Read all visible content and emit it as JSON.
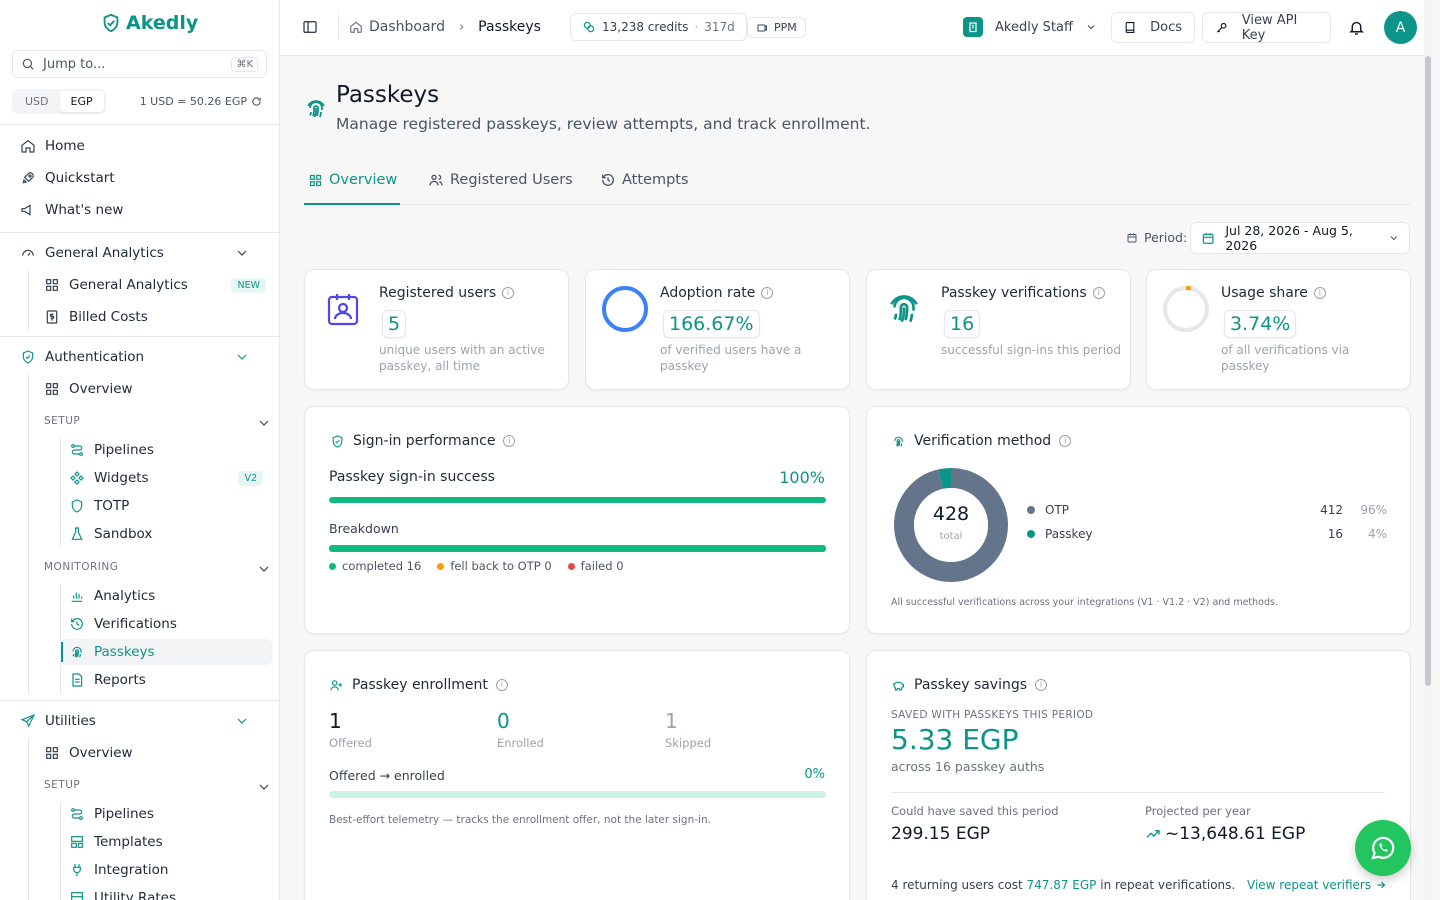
{
  "app": {
    "logo_text": "Akedly"
  },
  "sidebar": {
    "jump_placeholder": "Jump to...",
    "jump_shortcut": "⌘K",
    "currency": {
      "options": [
        "USD",
        "EGP"
      ],
      "selected": "EGP",
      "rate_text": "1 USD = 50.26 EGP"
    },
    "top_items": [
      {
        "label": "Home",
        "icon": "home-icon"
      },
      {
        "label": "Quickstart",
        "icon": "rocket-icon"
      },
      {
        "label": "What's new",
        "icon": "megaphone-icon"
      }
    ],
    "general_analytics": {
      "label": "General Analytics",
      "items": [
        {
          "label": "General Analytics",
          "badge": "NEW"
        },
        {
          "label": "Billed Costs"
        }
      ]
    },
    "authentication": {
      "label": "Authentication",
      "overview": "Overview",
      "setup_label": "SETUP",
      "setup_items": [
        {
          "label": "Pipelines"
        },
        {
          "label": "Widgets",
          "badge": "V2"
        },
        {
          "label": "TOTP"
        },
        {
          "label": "Sandbox"
        }
      ],
      "monitoring_label": "MONITORING",
      "monitoring_items": [
        {
          "label": "Analytics"
        },
        {
          "label": "Verifications"
        },
        {
          "label": "Passkeys",
          "active": true
        },
        {
          "label": "Reports"
        }
      ]
    },
    "utilities": {
      "label": "Utilities",
      "overview": "Overview",
      "setup_label": "SETUP",
      "setup_items": [
        {
          "label": "Pipelines"
        },
        {
          "label": "Templates"
        },
        {
          "label": "Integration"
        },
        {
          "label": "Utility Rates"
        }
      ]
    }
  },
  "topbar": {
    "breadcrumb": [
      "Dashboard",
      "Passkeys"
    ],
    "credits": "13,238 credits",
    "credits_days": "317d",
    "ppm_label": "PPM",
    "org_name": "Akedly Staff",
    "docs_label": "Docs",
    "api_key_label": "View API Key",
    "avatar_letter": "A"
  },
  "page": {
    "title": "Passkeys",
    "subtitle": "Manage registered passkeys, review attempts, and track enrollment.",
    "tabs": [
      {
        "label": "Overview",
        "active": true
      },
      {
        "label": "Registered Users"
      },
      {
        "label": "Attempts"
      }
    ],
    "period_label": "Period:",
    "period_value": "Jul 28, 2026 - Aug 5, 2026"
  },
  "stats": [
    {
      "title": "Registered users",
      "value": "5",
      "desc": "unique users with an active passkey, all time",
      "icon": "user-badge-icon"
    },
    {
      "title": "Adoption rate",
      "value": "166.67%",
      "desc": "of verified users have a passkey",
      "icon": "ring-icon"
    },
    {
      "title": "Passkey verifications",
      "value": "16",
      "desc": "successful sign-ins this period",
      "icon": "fingerprint-icon"
    },
    {
      "title": "Usage share",
      "value": "3.74%",
      "desc": "of all verifications via passkey",
      "icon": "usage-ring-icon",
      "fraction": 0.0374
    }
  ],
  "signin": {
    "title": "Sign-in performance",
    "success_label": "Passkey sign-in success",
    "success_value": "100%",
    "success_fraction": 1.0,
    "breakdown_label": "Breakdown",
    "legend": [
      {
        "label": "completed",
        "value": "16",
        "color": "#10b981"
      },
      {
        "label": "fell back to OTP",
        "value": "0",
        "color": "#f59e0b"
      },
      {
        "label": "failed",
        "value": "0",
        "color": "#ef4444"
      }
    ]
  },
  "verification_method": {
    "title": "Verification method",
    "total": "428",
    "total_label": "total",
    "rows": [
      {
        "label": "OTP",
        "count": "412",
        "pct": "96%",
        "color": "#64748b",
        "value": 412
      },
      {
        "label": "Passkey",
        "count": "16",
        "pct": "4%",
        "color": "#0d9488",
        "value": 16
      }
    ],
    "footnote": "All successful verifications across your integrations (V1 · V1.2 · V2) and methods."
  },
  "enrollment": {
    "title": "Passkey enrollment",
    "metrics": [
      {
        "value": "1",
        "label": "Offered"
      },
      {
        "value": "0",
        "label": "Enrolled"
      },
      {
        "value": "1",
        "label": "Skipped"
      }
    ],
    "conversion_label": "Offered → enrolled",
    "conversion_value": "0%",
    "conversion_fraction": 0,
    "note": "Best-effort telemetry — tracks the enrollment offer, not the later sign-in."
  },
  "savings": {
    "title": "Passkey savings",
    "kicker": "SAVED WITH PASSKEYS THIS PERIOD",
    "amount": "5.33 EGP",
    "sub": "across 16 passkey auths",
    "could_label": "Could have saved this period",
    "could_value": "299.15 EGP",
    "proj_label": "Projected per year",
    "proj_value": "~13,648.61 EGP",
    "footer_pre": "4 returning users cost",
    "footer_amount": "747.87 EGP",
    "footer_post": "in repeat verifications.",
    "link": "View repeat verifiers"
  },
  "colors": {
    "accent": "#0d9488",
    "success": "#10b981",
    "warning": "#f59e0b",
    "danger": "#ef4444",
    "otp": "#64748b",
    "whatsapp": "#22c55e"
  }
}
